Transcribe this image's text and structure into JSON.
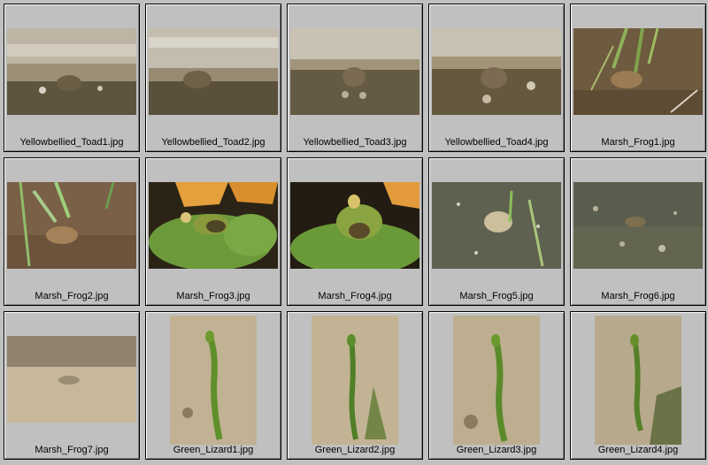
{
  "thumbnails": [
    {
      "filename": "Yellowbellied_Toad1.jpg"
    },
    {
      "filename": "Yellowbellied_Toad2.jpg"
    },
    {
      "filename": "Yellowbellied_Toad3.jpg"
    },
    {
      "filename": "Yellowbellied_Toad4.jpg"
    },
    {
      "filename": "Marsh_Frog1.jpg"
    },
    {
      "filename": "Marsh_Frog2.jpg"
    },
    {
      "filename": "Marsh_Frog3.jpg"
    },
    {
      "filename": "Marsh_Frog4.jpg"
    },
    {
      "filename": "Marsh_Frog5.jpg"
    },
    {
      "filename": "Marsh_Frog6.jpg"
    },
    {
      "filename": "Marsh_Frog7.jpg"
    },
    {
      "filename": "Green_Lizard1.jpg"
    },
    {
      "filename": "Green_Lizard2.jpg"
    },
    {
      "filename": "Green_Lizard3.jpg"
    },
    {
      "filename": "Green_Lizard4.jpg"
    }
  ]
}
